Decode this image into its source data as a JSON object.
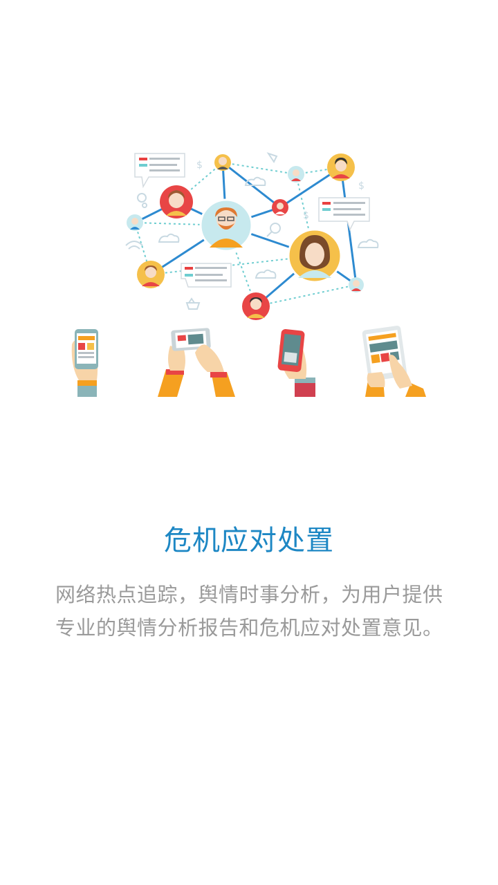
{
  "title": "危机应对处置",
  "description": "网络热点追踪，舆情时事分析，为用户提供专业的舆情分析报告和危机应对处置意见。",
  "colors": {
    "title": "#1d87c4",
    "description": "#9a9a9a",
    "network_line": "#2d8ad0",
    "dotted_line": "#6ecdd0"
  },
  "illustration": {
    "icon": "social-network-illustration"
  }
}
